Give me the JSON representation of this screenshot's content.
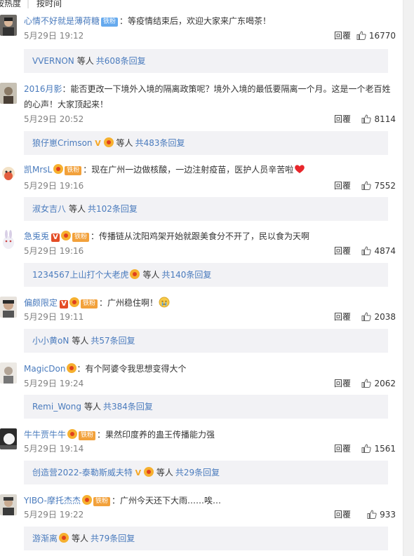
{
  "sort": {
    "hot": "按热度",
    "separator": "|",
    "time": "按时间"
  },
  "reply_label": "回覆",
  "etc_label": "等人",
  "comments": [
    {
      "user": "心情不好就是薄荷糖",
      "badge": "铁粉",
      "medal": false,
      "v": null,
      "text": "：等疫情结束后，欢迎大家来广东喝茶！",
      "time": "5月29日 19:12",
      "likes": "16770",
      "sub": {
        "name": "VVERNON",
        "v": null,
        "medal": false,
        "count": "共608条回复"
      }
    },
    {
      "user": "2016月影",
      "badge": null,
      "medal": false,
      "v": null,
      "text": "：能否更改一下境外入境的隔离政策呢？境外入境的最低要隔离一个月。这是一个老百姓的心声！大家顶起来！",
      "time": "5月29日 20:52",
      "likes": "8114",
      "sub": {
        "name": "狼仔崽Crimson",
        "v": "V",
        "medal": true,
        "count": "共483条回复"
      }
    },
    {
      "user": "凯MrsL",
      "badge": "铁粉",
      "medal": true,
      "v": null,
      "text": "：现在广州一边做核酸，一边注射疫苗，医护人员辛苦啦",
      "emoji": "heart",
      "time": "5月29日 19:16",
      "likes": "7552",
      "sub": {
        "name": "淑女吉八",
        "v": null,
        "medal": false,
        "count": "共102条回复"
      }
    },
    {
      "user": "急兎兎",
      "badge": "铁粉",
      "medal": true,
      "v": "V",
      "text": "：传播链从沈阳鸡架开始就跟美食分不开了，民以食为天啊",
      "time": "5月29日 19:16",
      "likes": "4874",
      "sub": {
        "name": "1234567上山打个大老虎",
        "v": null,
        "medal": true,
        "count": "共140条回复"
      }
    },
    {
      "user": "偏颇限定",
      "badge": "铁粉",
      "medal": true,
      "v": "V",
      "text": "：广州稳住啊！",
      "emoji": "cry",
      "time": "5月29日 19:11",
      "likes": "2038",
      "sub": {
        "name": "小小黄oN",
        "v": null,
        "medal": false,
        "count": "共57条回复"
      }
    },
    {
      "user": "MagicDon",
      "badge": null,
      "medal": true,
      "v": null,
      "text": "：有个阿婆令我思想变得大个",
      "time": "5月29日 19:24",
      "likes": "2062",
      "sub": {
        "name": "Remi_Wong",
        "v": null,
        "medal": false,
        "count": "共384条回复"
      }
    },
    {
      "user": "牛牛贾牛牛",
      "badge": "铁粉",
      "medal": true,
      "v": null,
      "text": "：果然印度养的蛊王传播能力强",
      "time": "5月29日 19:14",
      "likes": "1561",
      "sub": {
        "name": "创造营2022-泰勒斯威夫特",
        "v": "V",
        "medal": true,
        "count": "共29条回复"
      }
    },
    {
      "user": "YIBO-摩托杰杰",
      "badge": "铁粉",
      "medal": true,
      "v": null,
      "text": "：广州今天还下大雨……唉…",
      "time": "5月29日 19:22",
      "likes": "933",
      "sub": {
        "name": "游渐离",
        "v": null,
        "medal": true,
        "count": "共79条回复"
      }
    }
  ],
  "colors": {
    "link": "#4a7bbd",
    "name_orange": "#eb7350",
    "subbox_bg": "#f2f2f5",
    "meta_gray": "#808080"
  }
}
